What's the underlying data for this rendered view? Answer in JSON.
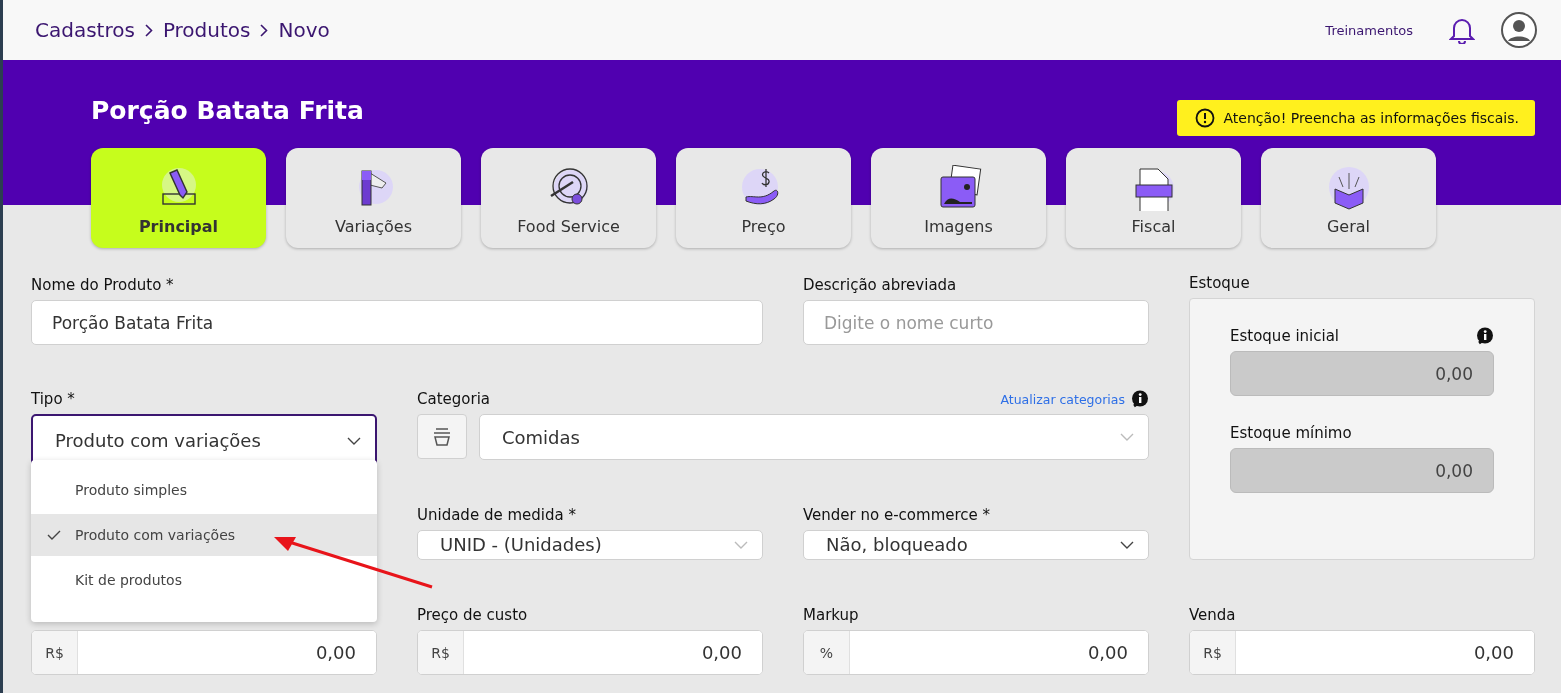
{
  "breadcrumb": [
    "Cadastros",
    "Produtos",
    "Novo"
  ],
  "header_link": "Treinamentos",
  "product_title": "Porção Batata Frita",
  "alert": "Atenção! Preencha as informações fiscais.",
  "tabs": [
    {
      "label": "Principal",
      "selected": true
    },
    {
      "label": "Variações",
      "selected": false
    },
    {
      "label": "Food Service",
      "selected": false
    },
    {
      "label": "Preço",
      "selected": false
    },
    {
      "label": "Imagens",
      "selected": false
    },
    {
      "label": "Fiscal",
      "selected": false
    },
    {
      "label": "Geral",
      "selected": false
    }
  ],
  "nome": {
    "label": "Nome do Produto *",
    "value": "Porção Batata Frita"
  },
  "descricao": {
    "label": "Descrição abreviada",
    "placeholder": "Digite o nome curto"
  },
  "estoque": {
    "title": "Estoque",
    "fields": [
      {
        "label": "Estoque inicial",
        "value": "0,00",
        "info": true
      },
      {
        "label": "Estoque mínimo",
        "value": "0,00",
        "info": false
      }
    ]
  },
  "tipo": {
    "label": "Tipo *",
    "value": "Produto com variações",
    "expanded": true,
    "options": [
      {
        "label": "Produto simples",
        "selected": false
      },
      {
        "label": "Produto com variações",
        "selected": true
      },
      {
        "label": "Kit de produtos",
        "selected": false
      }
    ]
  },
  "categoria": {
    "label": "Categoria",
    "link": "Atualizar categorias",
    "value": "Comidas"
  },
  "unidade": {
    "label": "Unidade de medida *",
    "value": "UNID - (Unidades)"
  },
  "ecommerce": {
    "label": "Vender no e-commerce *",
    "value": "Não, bloqueado"
  },
  "prices": [
    {
      "prefix": "R$",
      "value": "0,00"
    },
    {
      "label": "Preço de custo",
      "prefix": "R$",
      "value": "0,00"
    },
    {
      "label": "Markup",
      "prefix": "%",
      "value": "0,00"
    },
    {
      "label": "Venda",
      "prefix": "R$",
      "value": "0,00"
    }
  ]
}
